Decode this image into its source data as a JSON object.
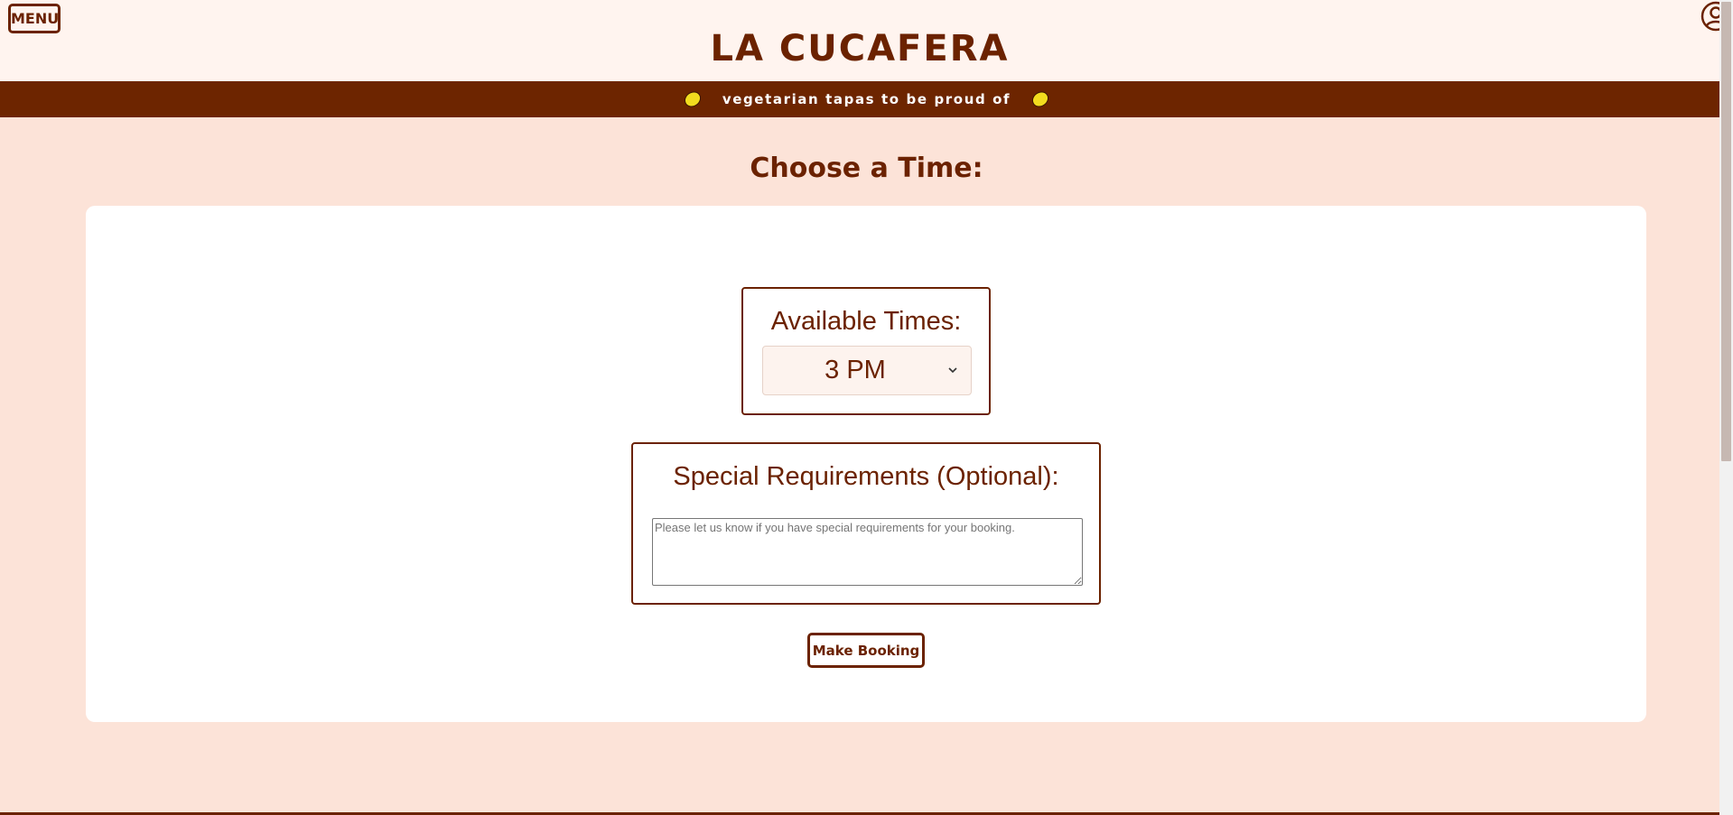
{
  "header": {
    "menu_label": "MENU",
    "site_title": "LA CUCAFERA",
    "account_icon": "user-circle-icon"
  },
  "tagline": {
    "text": "vegetarian tapas to be proud of",
    "icon": "lemon-icon",
    "icon_color": "#f2dc1e"
  },
  "page": {
    "heading": "Choose a Time:"
  },
  "times": {
    "label": "Available Times:",
    "selected": "3 PM"
  },
  "requirements": {
    "label": "Special Requirements (Optional):",
    "placeholder": "Please let us know if you have special requirements for your booking.",
    "value": ""
  },
  "actions": {
    "make_booking_label": "Make Booking"
  },
  "colors": {
    "brand": "#6b2200",
    "page_background": "#fce3d8",
    "header_background": "#fff4ef",
    "card_background": "#ffffff"
  }
}
